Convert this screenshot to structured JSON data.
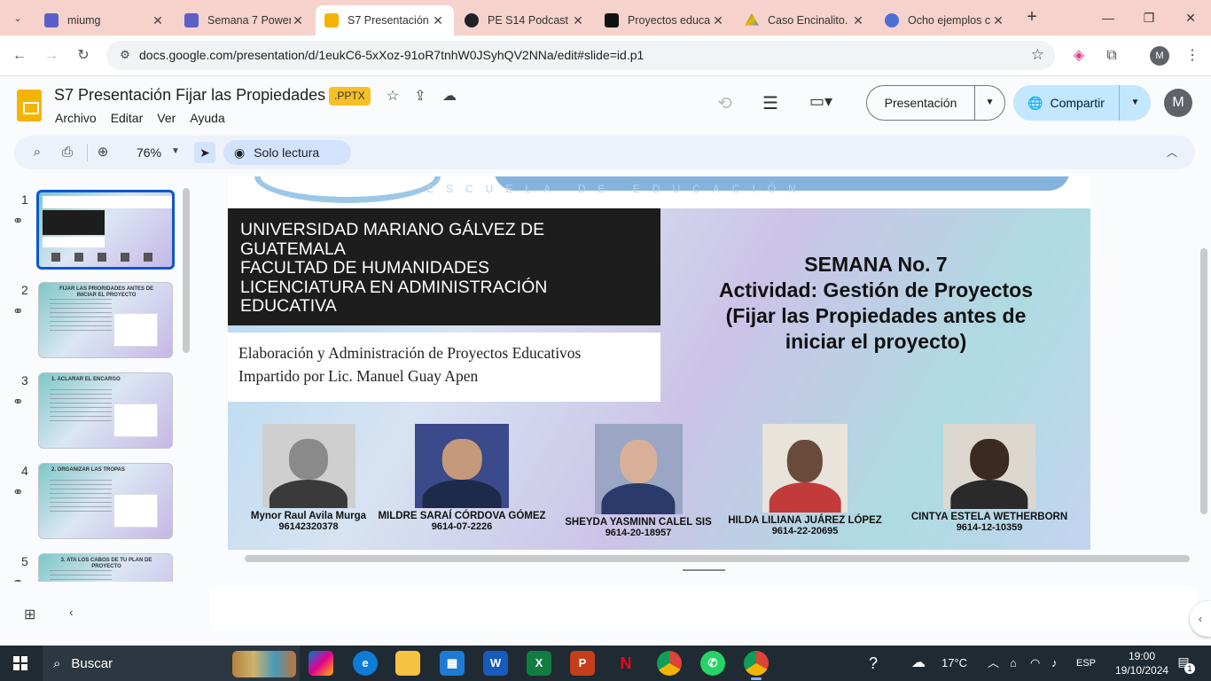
{
  "browser": {
    "tabs": [
      {
        "title": "miumg",
        "favicon": "teams-icon",
        "color": "#5b5fc7"
      },
      {
        "title": "Semana 7 Power",
        "favicon": "teams-icon",
        "color": "#5b5fc7"
      },
      {
        "title": "S7 Presentación",
        "favicon": "slides-icon",
        "color": "#f4b400",
        "active": true
      },
      {
        "title": "PE S14 Podcast",
        "favicon": "podcast-icon",
        "color": "#202124"
      },
      {
        "title": "Proyectos educa",
        "favicon": "obs-icon",
        "color": "#111111"
      },
      {
        "title": "Caso Encinalito.",
        "favicon": "drive-icon",
        "color": "#0f9d58"
      },
      {
        "title": "Ocho ejemplos c",
        "favicon": "web-icon",
        "color": "#4b6fd6"
      }
    ],
    "url": "docs.google.com/presentation/d/1eukC6-5xXoz-91oR7tnhW0JSyhQV2NNa/edit#slide=id.p1",
    "profile_initial": "M"
  },
  "docs": {
    "title": "S7 Presentación Fijar las Propiedades",
    "badge": ".PPTX",
    "menu": [
      "Archivo",
      "Editar",
      "Ver",
      "Ayuda"
    ],
    "present_label": "Presentación",
    "share_label": "Compartir",
    "avatar_initial": "M",
    "zoom": "76%",
    "readonly_label": "Solo lectura",
    "accent": "#0b57d0"
  },
  "filmstrip": [
    {
      "num": "1",
      "title": "",
      "selected": true
    },
    {
      "num": "2",
      "title": "FIJAR LAS PRIORIDADES ANTES DE INICIAR EL PROYECTO"
    },
    {
      "num": "3",
      "title": "1. ACLARAR EL ENCARGO"
    },
    {
      "num": "4",
      "title": "2. ORGANIZAR LAS TROPAS"
    },
    {
      "num": "5",
      "title": "3. ATA LOS CABOS DE TU PLAN DE PROYECTO"
    }
  ],
  "slide": {
    "logo_sub": "ESCUELA DE EDUCACIÓN",
    "university": [
      "UNIVERSIDAD MARIANO GÁLVEZ DE",
      "GUATEMALA",
      "FACULTAD DE HUMANIDADES",
      "LICENCIATURA EN ADMINISTRACIÓN",
      "EDUCATIVA"
    ],
    "course": [
      "Elaboración y Administración de Proyectos Educativos",
      "Impartido por Lic. Manuel Guay Apen"
    ],
    "heading": [
      "SEMANA No. 7",
      "Actividad: Gestión de Proyectos",
      "(Fijar las Propiedades antes de",
      "iniciar el proyecto)"
    ],
    "people": [
      {
        "name": "Mynor Raul Avila Murga",
        "id": "96142320378"
      },
      {
        "name": "MILDRE SARAÍ CÓRDOVA GÓMEZ",
        "id": "9614-07-2226"
      },
      {
        "name": "SHEYDA YASMINN CALEL SIS",
        "id": "9614-20-18957"
      },
      {
        "name": "HILDA LILIANA JUÁREZ LÓPEZ",
        "id": "9614-22-20695"
      },
      {
        "name": "CINTYA ESTELA WETHERBORN",
        "id": "9614-12-10359"
      }
    ]
  },
  "taskbar": {
    "search_placeholder": "Buscar",
    "temperature": "17°C",
    "language": "ESP",
    "time": "19:00",
    "date": "19/10/2024",
    "notifications": "1"
  }
}
